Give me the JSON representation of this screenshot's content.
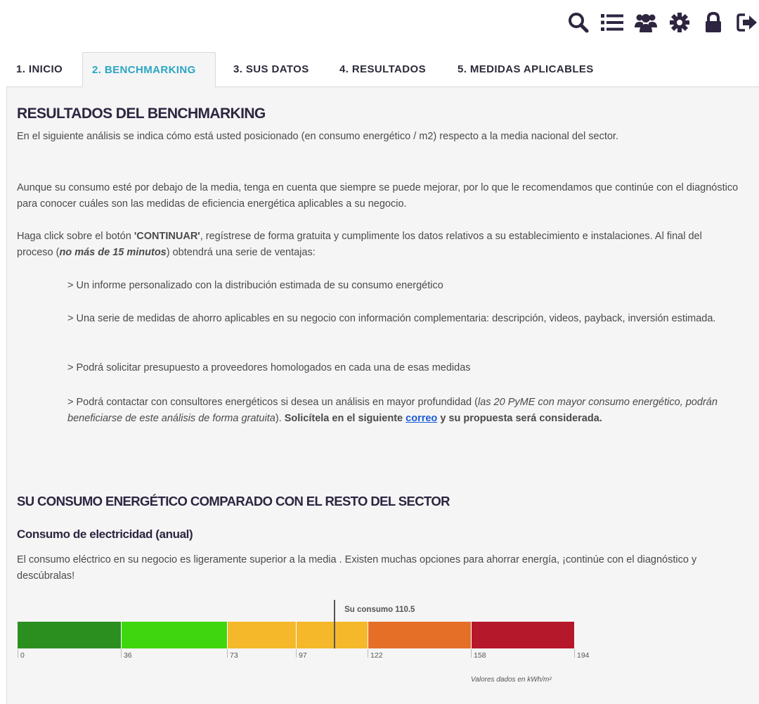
{
  "toolbar": {
    "icons": [
      "search-icon",
      "list-icon",
      "users-icon",
      "gear-icon",
      "lock-icon",
      "logout-icon"
    ],
    "icon_color": "#2e2540"
  },
  "tabs": [
    {
      "label": "1. INICIO",
      "active": false
    },
    {
      "label": "2. BENCHMARKING",
      "active": true
    },
    {
      "label": "3. SUS DATOS",
      "active": false
    },
    {
      "label": "4. RESULTADOS",
      "active": false
    },
    {
      "label": "5. MEDIDAS APLICABLES",
      "active": false
    }
  ],
  "content": {
    "title": "RESULTADOS DEL BENCHMARKING",
    "para1": "En el siguiente análisis se indica cómo está usted posicionado (en consumo energético / m2) respecto a la media nacional del sector.",
    "para2": "Aunque su consumo esté por debajo de la media, tenga en cuenta que siempre se puede mejorar, por lo que le recomendamos que continúe con el diagnóstico para conocer cuáles son las medidas de eficiencia energética aplicables a su negocio.",
    "para3_a": "Haga click sobre el botón ",
    "para3_bold": "'CONTINUAR'",
    "para3_b": ", regístrese de forma gratuita y cumplimente los datos relativos a su establecimiento e instalaciones. Al final del proceso (",
    "para3_italic": "no más de 15 minutos",
    "para3_c": ") obtendrá una serie de ventajas:",
    "bullet1": "> Un informe personalizado con la distribución estimada de su consumo energético",
    "bullet2": "> Una serie de medidas de ahorro aplicables en su negocio con información complementaria: descripción, videos, payback, inversión estimada.",
    "bullet3": "> Podrá solicitar presupuesto a proveedores homologados en cada una de esas medidas",
    "bullet4_a": "> Podrá contactar con consultores energéticos si desea un análisis en mayor profundidad (",
    "bullet4_italic": "las 20 PyME con mayor consumo energético, podrán beneficiarse de este análisis de forma gratuita",
    "bullet4_b": ").  ",
    "bullet4_bold_a": "Solicítela en el siguiente ",
    "bullet4_link": "correo",
    "bullet4_bold_b": " y su propuesta será considerada.",
    "section_title": "SU CONSUMO ENERGÉTICO COMPARADO CON EL RESTO DEL SECTOR",
    "subsection_title": "Consumo de electricidad (anual)",
    "subsection_text": "El consumo eléctrico en su negocio es ligeramente superior a la media . Existen muchas opciones para ahorrar energía, ¡continúe con el diagnóstico y descúbralas!"
  },
  "chart_data": {
    "type": "bar",
    "orientation": "horizontal-scale",
    "range": [
      0,
      194
    ],
    "segments": [
      {
        "from": 0,
        "to": 36,
        "color": "#2a8f1e"
      },
      {
        "from": 36,
        "to": 73,
        "color": "#3fd60f"
      },
      {
        "from": 73,
        "to": 97,
        "color": "#f5b82a"
      },
      {
        "from": 97,
        "to": 122,
        "color": "#f5b82a"
      },
      {
        "from": 122,
        "to": 158,
        "color": "#e56f26"
      },
      {
        "from": 158,
        "to": 194,
        "color": "#b5172b"
      }
    ],
    "ticks": [
      "0",
      "36",
      "73",
      "97",
      "122",
      "158",
      "194"
    ],
    "tick_values": [
      0,
      36,
      73,
      97,
      122,
      158,
      194
    ],
    "marker": {
      "label": "Su consumo 110.5",
      "value": 110.5
    },
    "units_label": "Valores dados en kWh/m²"
  }
}
